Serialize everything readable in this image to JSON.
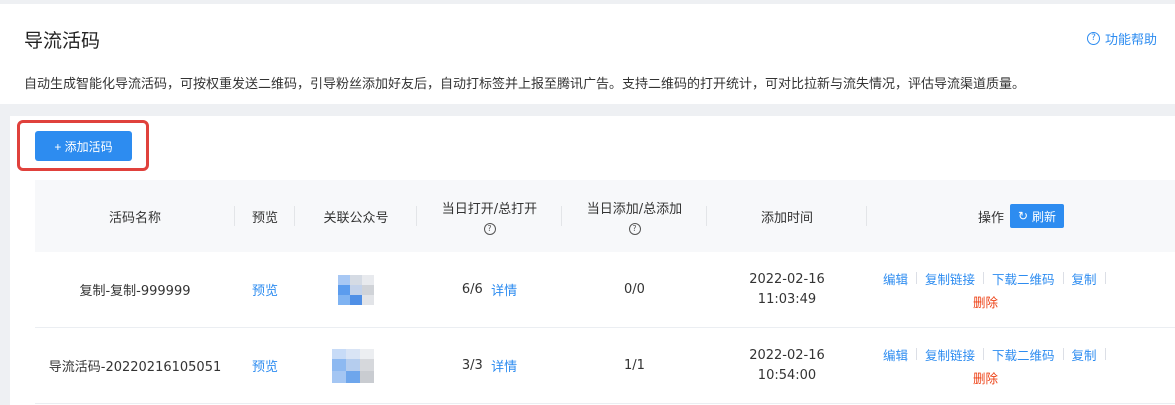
{
  "header": {
    "title": "导流活码",
    "help_label": "功能帮助",
    "description": "自动生成智能化导流活码，可按权重发送二维码，引导粉丝添加好友后，自动打标签并上报至腾讯广告。支持二维码的打开统计，可对比拉新与流失情况，评估导流渠道质量。"
  },
  "toolbar": {
    "add_label": "+ 添加活码"
  },
  "table": {
    "columns": [
      "活码名称",
      "预览",
      "关联公众号",
      "当日打开/总打开",
      "当日添加/总添加",
      "添加时间",
      "操作"
    ],
    "refresh_label": "刷新",
    "rows": [
      {
        "name": "复制-复制-999999",
        "preview": "预览",
        "opens": "6/6",
        "detail": "详情",
        "adds": "0/0",
        "date": "2022-02-16",
        "time": "11:03:49"
      },
      {
        "name": "导流活码-20220216105051",
        "preview": "预览",
        "opens": "3/3",
        "detail": "详情",
        "adds": "1/1",
        "date": "2022-02-16",
        "time": "10:54:00"
      }
    ],
    "actions": {
      "edit": "编辑",
      "copy_link": "复制链接",
      "download_qr": "下载二维码",
      "copy": "复制",
      "delete": "删除"
    }
  },
  "colors": {
    "accent": "#2d8cf0",
    "danger": "#ed4014",
    "highlight": "#e0413c"
  },
  "icons": {
    "help": "question-circle-icon",
    "refresh": "refresh-icon",
    "hint": "question-circle-icon"
  }
}
